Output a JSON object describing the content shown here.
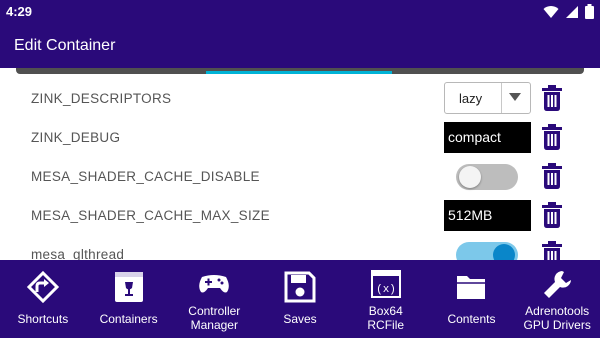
{
  "status_bar": {
    "time": "4:29"
  },
  "app_bar": {
    "title": "Edit Container"
  },
  "colors": {
    "primary": "#2a0a7a",
    "accent": "#00b3d6",
    "toggle_on": "#0a86c9",
    "trash": "#2a0a7a"
  },
  "env_vars": [
    {
      "name": "ZINK_DESCRIPTORS",
      "control": "select",
      "value": "lazy"
    },
    {
      "name": "ZINK_DEBUG",
      "control": "text",
      "value": "compact"
    },
    {
      "name": "MESA_SHADER_CACHE_DISABLE",
      "control": "toggle",
      "value": false
    },
    {
      "name": "MESA_SHADER_CACHE_MAX_SIZE",
      "control": "text",
      "value": "512MB"
    },
    {
      "name": "mesa_glthread",
      "control": "toggle",
      "value": true
    }
  ],
  "bottom_nav": [
    {
      "label_line1": "Shortcuts",
      "label_line2": "",
      "icon": "shortcut-icon"
    },
    {
      "label_line1": "Containers",
      "label_line2": "",
      "icon": "container-box-icon"
    },
    {
      "label_line1": "Controller",
      "label_line2": "Manager",
      "icon": "gamepad-icon"
    },
    {
      "label_line1": "Saves",
      "label_line2": "",
      "icon": "floppy-disk-icon"
    },
    {
      "label_line1": "Box64",
      "label_line2": "RCFile",
      "icon": "variable-window-icon"
    },
    {
      "label_line1": "Contents",
      "label_line2": "",
      "icon": "folder-icon"
    },
    {
      "label_line1": "Adrenotools",
      "label_line2": "GPU Drivers",
      "icon": "wrench-icon"
    }
  ]
}
